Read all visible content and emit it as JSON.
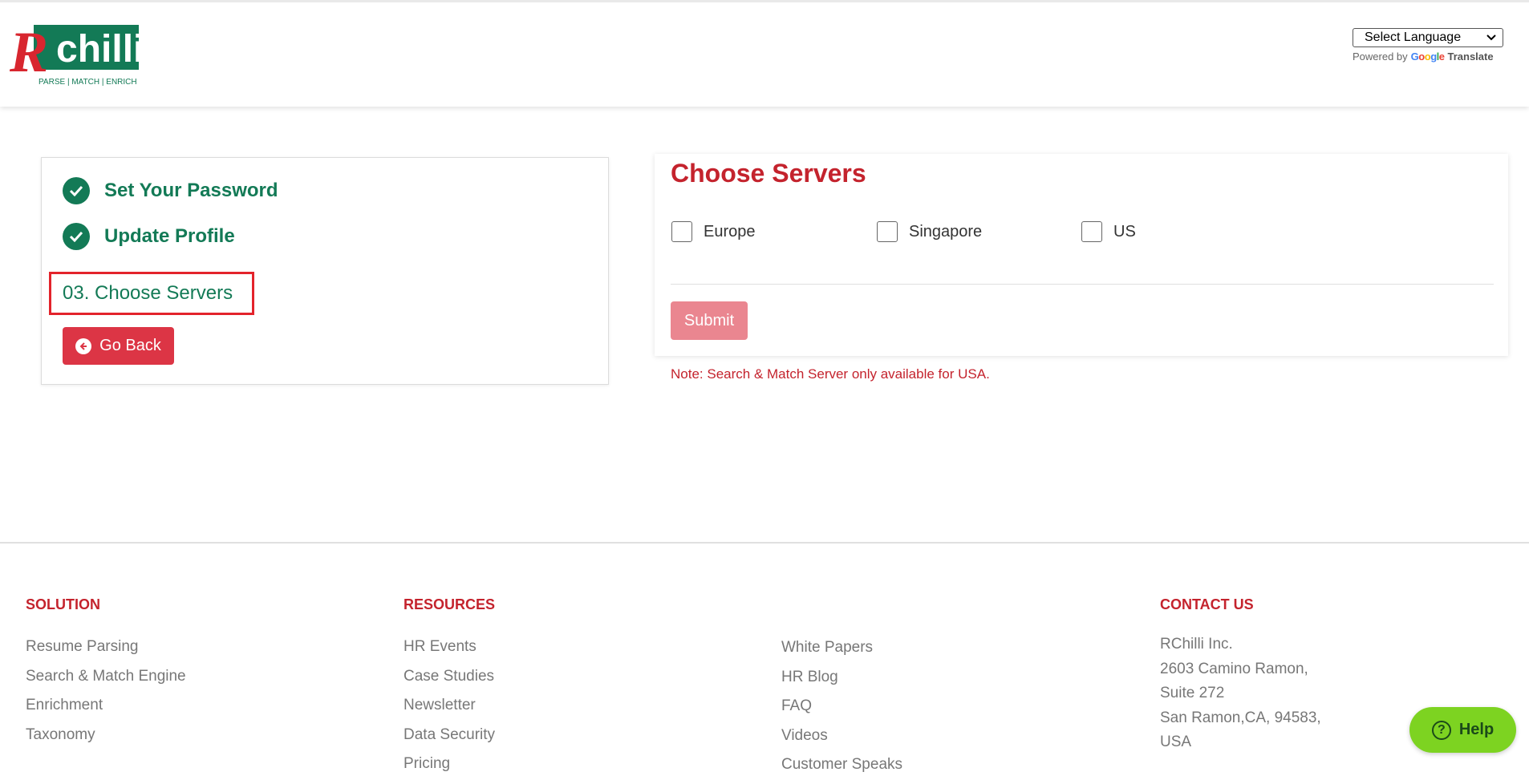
{
  "header": {
    "logo_text": "Rchilli",
    "logo_tagline": "PARSE | MATCH | ENRICH",
    "language_select": "Select Language",
    "powered_by": "Powered by",
    "google": [
      "G",
      "o",
      "o",
      "g",
      "l",
      "e"
    ],
    "translate": "Translate"
  },
  "steps": {
    "done": [
      "Set Your Password",
      "Update Profile"
    ],
    "current": "03. Choose Servers",
    "go_back": "Go Back"
  },
  "servers": {
    "title": "Choose Servers",
    "options": [
      "Europe",
      "Singapore",
      "US"
    ],
    "submit": "Submit",
    "note": "Note: Search & Match Server only available for USA."
  },
  "footer": {
    "solution": {
      "heading": "SOLUTION",
      "links": [
        "Resume Parsing",
        "Search & Match Engine",
        "Enrichment",
        "Taxonomy"
      ]
    },
    "resources": {
      "heading": "RESOURCES",
      "links": [
        "HR Events",
        "Case Studies",
        "Newsletter",
        "Data Security",
        "Pricing"
      ]
    },
    "resources2": {
      "links": [
        "White Papers",
        "HR Blog",
        "FAQ",
        "Videos",
        "Customer Speaks"
      ]
    },
    "contact": {
      "heading": "CONTACT US",
      "lines": [
        "RChilli Inc.",
        "2603 Camino Ramon,",
        "Suite 272",
        "San Ramon,CA, 94583,",
        "USA"
      ]
    }
  },
  "help": "Help",
  "colors": {
    "green": "#137a56",
    "red": "#c4232d",
    "button_red": "#dc3545",
    "help_green": "#7dd321"
  }
}
